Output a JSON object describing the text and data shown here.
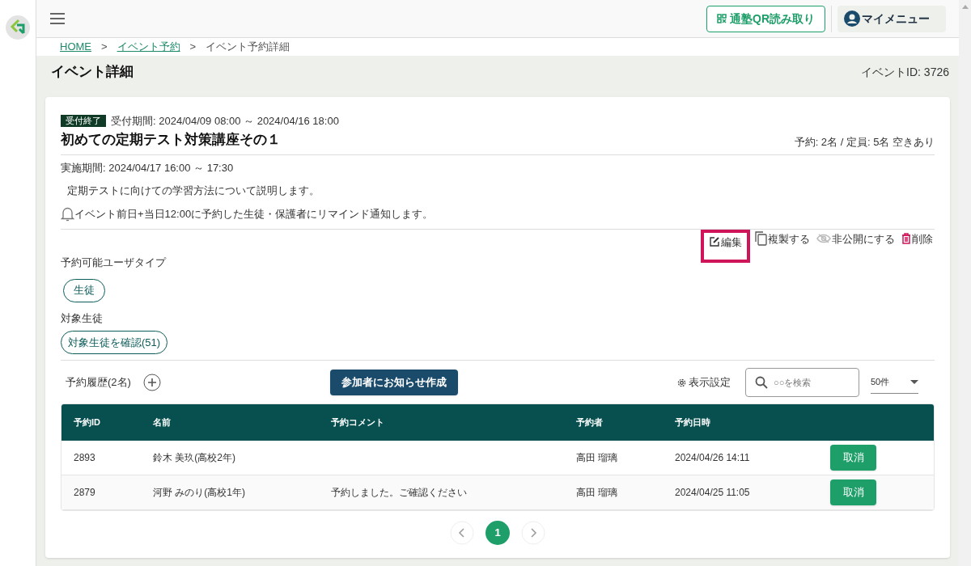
{
  "header": {
    "qr_button": "通塾QR読み取り",
    "menu_button": "マイメニュー"
  },
  "breadcrumbs": [
    {
      "label": "HOME",
      "link": true
    },
    {
      "label": "イベント予約",
      "link": true
    },
    {
      "label": "イベント予約詳細",
      "link": false
    }
  ],
  "breadcrumb_separator": ">",
  "page": {
    "title": "イベント詳細",
    "event_id": "イベントID: 3726"
  },
  "event": {
    "status": "受付終了",
    "reception_period": "受付期間: 2024/04/09 08:00 ～ 2024/04/16 18:00",
    "name": "初めての定期テスト対策講座その１",
    "capacity": "予約: 2名 / 定員: 5名 空きあり",
    "period": "実施期間: 2024/04/17 16:00 ～ 17:30",
    "description": "定期テストに向けての学習方法について説明します。",
    "reminder": "イベント前日+当日12:00に予約した生徒・保護者にリマインド通知します。"
  },
  "actions": [
    {
      "kind": "edit",
      "label": "編集",
      "highlighted": true
    },
    {
      "kind": "copy",
      "label": "複製する",
      "highlighted": false
    },
    {
      "kind": "hide",
      "label": "非公開にする",
      "highlighted": false
    },
    {
      "kind": "delete",
      "label": "削除",
      "highlighted": false
    }
  ],
  "user_types": {
    "label": "予約可能ユーザタイプ",
    "chips": [
      "生徒"
    ]
  },
  "target": {
    "label": "対象生徒",
    "button": "対象生徒を確認(51)"
  },
  "reservations": {
    "title": "予約履歴(2名)",
    "notify_button": "参加者にお知らせ作成",
    "display_settings": "表示設定",
    "search_placeholder": "○○を検索",
    "per_page": "50件",
    "columns": [
      "予約ID",
      "名前",
      "予約コメント",
      "予約者",
      "予約日時"
    ],
    "rows": [
      {
        "id": "2893",
        "name": "鈴木 美玖(高校2年)",
        "comment": "",
        "reserver": "高田 瑠璃",
        "datetime": "2024/04/26 14:11",
        "action": "取消"
      },
      {
        "id": "2879",
        "name": "河野 みのり(高校1年)",
        "comment": "予約しました。ご確認ください",
        "reserver": "高田 瑠璃",
        "datetime": "2024/04/25 11:05",
        "action": "取消"
      }
    ]
  },
  "pagination": {
    "pages": [
      {
        "label": "1",
        "selected": true
      }
    ]
  }
}
